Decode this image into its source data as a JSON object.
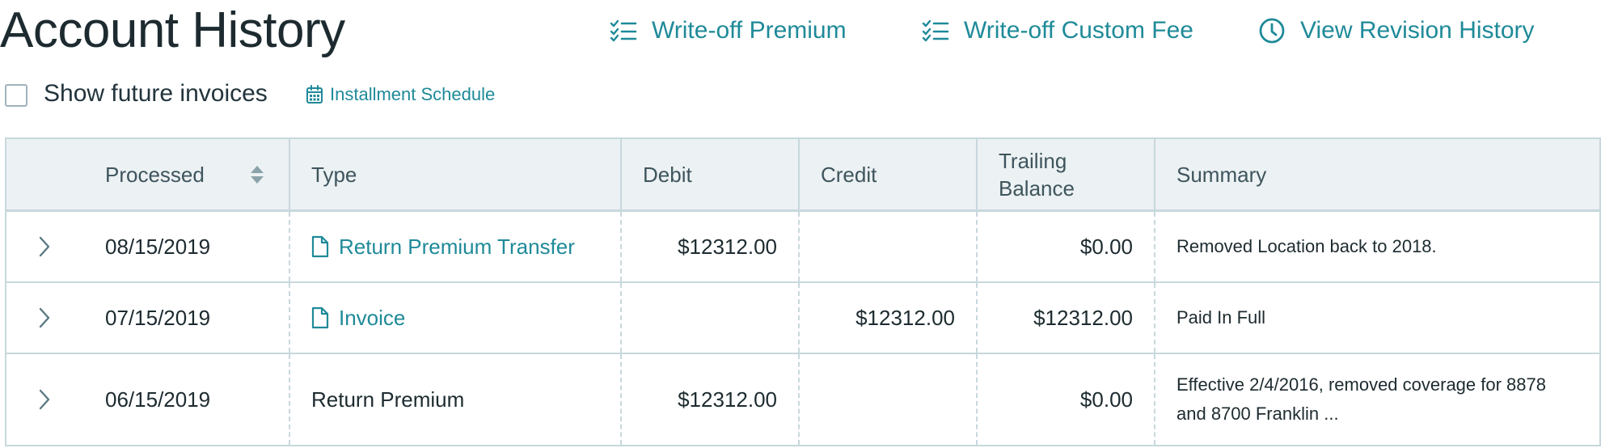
{
  "page": {
    "title": "Account History"
  },
  "actions": {
    "writeoff_premium": "Write-off Premium",
    "writeoff_custom_fee": "Write-off Custom Fee",
    "view_revision_history": "View Revision History"
  },
  "filters": {
    "show_future_invoices": "Show future invoices",
    "show_future_invoices_checked": false,
    "installment_schedule": "Installment Schedule"
  },
  "table": {
    "headers": {
      "processed": "Processed",
      "type": "Type",
      "debit": "Debit",
      "credit": "Credit",
      "trailing_balance_line1": "Trailing",
      "trailing_balance_line2": "Balance",
      "summary": "Summary"
    },
    "rows": [
      {
        "processed": "08/15/2019",
        "type": "Return Premium Transfer",
        "type_is_link": true,
        "debit": "$12312.00",
        "credit": "",
        "trailing_balance": "$0.00",
        "summary": "Removed Location back to 2018."
      },
      {
        "processed": "07/15/2019",
        "type": "Invoice",
        "type_is_link": true,
        "debit": "",
        "credit": "$12312.00",
        "trailing_balance": "$12312.00",
        "summary": "Paid In Full"
      },
      {
        "processed": "06/15/2019",
        "type": "Return Premium",
        "type_is_link": false,
        "debit": "$12312.00",
        "credit": "",
        "trailing_balance": "$0.00",
        "summary": "Effective 2/4/2016, removed coverage for 8878 and 8700 Franklin ..."
      }
    ]
  },
  "colors": {
    "accent": "#1f8a99",
    "header_bg": "#ecf1f3",
    "border": "#c7d8dd",
    "text": "#1d2b30"
  },
  "icons": {
    "writeoff_premium": "checklist-icon",
    "writeoff_custom_fee": "checklist-icon",
    "view_revision_history": "clock-icon",
    "installment_schedule": "calendar-icon",
    "document": "document-icon",
    "expand": "chevron-right-icon",
    "sort": "sort-icon"
  }
}
